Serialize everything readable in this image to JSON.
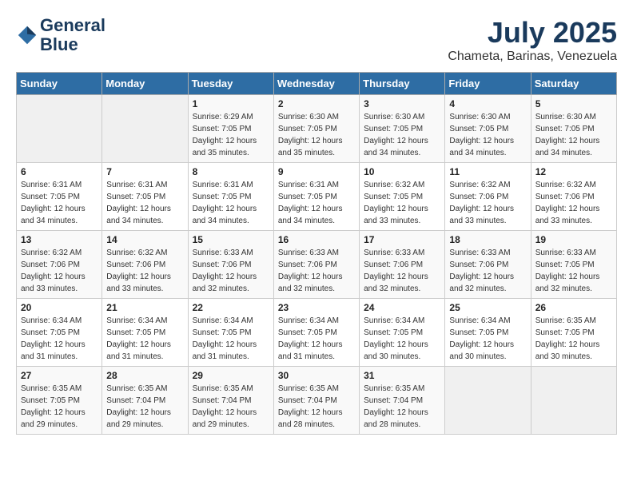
{
  "header": {
    "logo_line1": "General",
    "logo_line2": "Blue",
    "month_year": "July 2025",
    "location": "Chameta, Barinas, Venezuela"
  },
  "days_of_week": [
    "Sunday",
    "Monday",
    "Tuesday",
    "Wednesday",
    "Thursday",
    "Friday",
    "Saturday"
  ],
  "weeks": [
    [
      {
        "num": "",
        "sunrise": "",
        "sunset": "",
        "daylight": ""
      },
      {
        "num": "",
        "sunrise": "",
        "sunset": "",
        "daylight": ""
      },
      {
        "num": "1",
        "sunrise": "Sunrise: 6:29 AM",
        "sunset": "Sunset: 7:05 PM",
        "daylight": "Daylight: 12 hours and 35 minutes."
      },
      {
        "num": "2",
        "sunrise": "Sunrise: 6:30 AM",
        "sunset": "Sunset: 7:05 PM",
        "daylight": "Daylight: 12 hours and 35 minutes."
      },
      {
        "num": "3",
        "sunrise": "Sunrise: 6:30 AM",
        "sunset": "Sunset: 7:05 PM",
        "daylight": "Daylight: 12 hours and 34 minutes."
      },
      {
        "num": "4",
        "sunrise": "Sunrise: 6:30 AM",
        "sunset": "Sunset: 7:05 PM",
        "daylight": "Daylight: 12 hours and 34 minutes."
      },
      {
        "num": "5",
        "sunrise": "Sunrise: 6:30 AM",
        "sunset": "Sunset: 7:05 PM",
        "daylight": "Daylight: 12 hours and 34 minutes."
      }
    ],
    [
      {
        "num": "6",
        "sunrise": "Sunrise: 6:31 AM",
        "sunset": "Sunset: 7:05 PM",
        "daylight": "Daylight: 12 hours and 34 minutes."
      },
      {
        "num": "7",
        "sunrise": "Sunrise: 6:31 AM",
        "sunset": "Sunset: 7:05 PM",
        "daylight": "Daylight: 12 hours and 34 minutes."
      },
      {
        "num": "8",
        "sunrise": "Sunrise: 6:31 AM",
        "sunset": "Sunset: 7:05 PM",
        "daylight": "Daylight: 12 hours and 34 minutes."
      },
      {
        "num": "9",
        "sunrise": "Sunrise: 6:31 AM",
        "sunset": "Sunset: 7:05 PM",
        "daylight": "Daylight: 12 hours and 34 minutes."
      },
      {
        "num": "10",
        "sunrise": "Sunrise: 6:32 AM",
        "sunset": "Sunset: 7:05 PM",
        "daylight": "Daylight: 12 hours and 33 minutes."
      },
      {
        "num": "11",
        "sunrise": "Sunrise: 6:32 AM",
        "sunset": "Sunset: 7:06 PM",
        "daylight": "Daylight: 12 hours and 33 minutes."
      },
      {
        "num": "12",
        "sunrise": "Sunrise: 6:32 AM",
        "sunset": "Sunset: 7:06 PM",
        "daylight": "Daylight: 12 hours and 33 minutes."
      }
    ],
    [
      {
        "num": "13",
        "sunrise": "Sunrise: 6:32 AM",
        "sunset": "Sunset: 7:06 PM",
        "daylight": "Daylight: 12 hours and 33 minutes."
      },
      {
        "num": "14",
        "sunrise": "Sunrise: 6:32 AM",
        "sunset": "Sunset: 7:06 PM",
        "daylight": "Daylight: 12 hours and 33 minutes."
      },
      {
        "num": "15",
        "sunrise": "Sunrise: 6:33 AM",
        "sunset": "Sunset: 7:06 PM",
        "daylight": "Daylight: 12 hours and 32 minutes."
      },
      {
        "num": "16",
        "sunrise": "Sunrise: 6:33 AM",
        "sunset": "Sunset: 7:06 PM",
        "daylight": "Daylight: 12 hours and 32 minutes."
      },
      {
        "num": "17",
        "sunrise": "Sunrise: 6:33 AM",
        "sunset": "Sunset: 7:06 PM",
        "daylight": "Daylight: 12 hours and 32 minutes."
      },
      {
        "num": "18",
        "sunrise": "Sunrise: 6:33 AM",
        "sunset": "Sunset: 7:06 PM",
        "daylight": "Daylight: 12 hours and 32 minutes."
      },
      {
        "num": "19",
        "sunrise": "Sunrise: 6:33 AM",
        "sunset": "Sunset: 7:05 PM",
        "daylight": "Daylight: 12 hours and 32 minutes."
      }
    ],
    [
      {
        "num": "20",
        "sunrise": "Sunrise: 6:34 AM",
        "sunset": "Sunset: 7:05 PM",
        "daylight": "Daylight: 12 hours and 31 minutes."
      },
      {
        "num": "21",
        "sunrise": "Sunrise: 6:34 AM",
        "sunset": "Sunset: 7:05 PM",
        "daylight": "Daylight: 12 hours and 31 minutes."
      },
      {
        "num": "22",
        "sunrise": "Sunrise: 6:34 AM",
        "sunset": "Sunset: 7:05 PM",
        "daylight": "Daylight: 12 hours and 31 minutes."
      },
      {
        "num": "23",
        "sunrise": "Sunrise: 6:34 AM",
        "sunset": "Sunset: 7:05 PM",
        "daylight": "Daylight: 12 hours and 31 minutes."
      },
      {
        "num": "24",
        "sunrise": "Sunrise: 6:34 AM",
        "sunset": "Sunset: 7:05 PM",
        "daylight": "Daylight: 12 hours and 30 minutes."
      },
      {
        "num": "25",
        "sunrise": "Sunrise: 6:34 AM",
        "sunset": "Sunset: 7:05 PM",
        "daylight": "Daylight: 12 hours and 30 minutes."
      },
      {
        "num": "26",
        "sunrise": "Sunrise: 6:35 AM",
        "sunset": "Sunset: 7:05 PM",
        "daylight": "Daylight: 12 hours and 30 minutes."
      }
    ],
    [
      {
        "num": "27",
        "sunrise": "Sunrise: 6:35 AM",
        "sunset": "Sunset: 7:05 PM",
        "daylight": "Daylight: 12 hours and 29 minutes."
      },
      {
        "num": "28",
        "sunrise": "Sunrise: 6:35 AM",
        "sunset": "Sunset: 7:04 PM",
        "daylight": "Daylight: 12 hours and 29 minutes."
      },
      {
        "num": "29",
        "sunrise": "Sunrise: 6:35 AM",
        "sunset": "Sunset: 7:04 PM",
        "daylight": "Daylight: 12 hours and 29 minutes."
      },
      {
        "num": "30",
        "sunrise": "Sunrise: 6:35 AM",
        "sunset": "Sunset: 7:04 PM",
        "daylight": "Daylight: 12 hours and 28 minutes."
      },
      {
        "num": "31",
        "sunrise": "Sunrise: 6:35 AM",
        "sunset": "Sunset: 7:04 PM",
        "daylight": "Daylight: 12 hours and 28 minutes."
      },
      {
        "num": "",
        "sunrise": "",
        "sunset": "",
        "daylight": ""
      },
      {
        "num": "",
        "sunrise": "",
        "sunset": "",
        "daylight": ""
      }
    ]
  ]
}
